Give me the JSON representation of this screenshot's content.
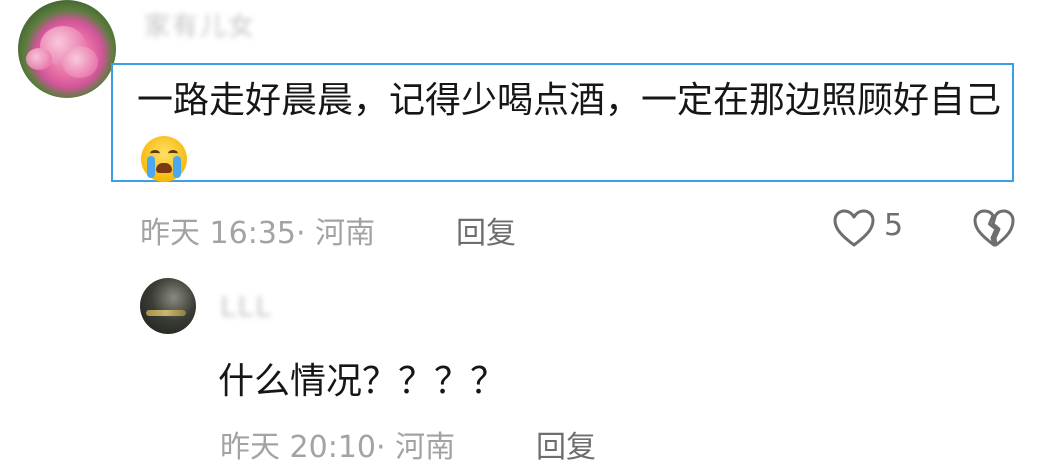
{
  "comment": {
    "username": "家有儿女",
    "text": "一路走好晨晨，记得少喝点酒，一定在那边照顾好自己",
    "emoji": "loudly-crying-face-icon",
    "time": "昨天 16:35",
    "location": "· 河南",
    "reply_label": "回复",
    "like_count": "5"
  },
  "reply": {
    "username": "LLL",
    "text": "什么情况？？？？",
    "time": "昨天 20:10",
    "location": "· 河南",
    "reply_label": "回复"
  },
  "colors": {
    "highlight_border": "#3aa0e6",
    "meta_text": "#a3a3a3"
  }
}
